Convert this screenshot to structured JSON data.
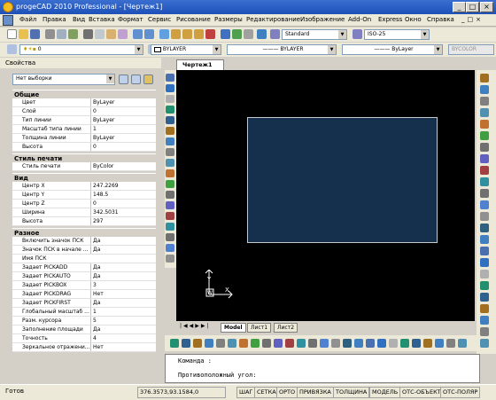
{
  "window": {
    "title": "progeCAD 2010 Professional - [Чертеж1]"
  },
  "menu": [
    "Файл",
    "Правка",
    "Вид",
    "Вставка",
    "Формат",
    "Сервис",
    "Рисование",
    "Размеры",
    "Редактирование",
    "Изображение",
    "Add-On",
    "Express",
    "Окно",
    "Справка"
  ],
  "toolbar": {
    "layer_value": "0",
    "color_value": "BYLAYER",
    "linetype_value": "BYLAYER",
    "lineweight_value": "ByLayer",
    "plotstyle_value": "BYCOLOR",
    "textstyle_value": "Standard",
    "dimstyle_value": "ISO-25"
  },
  "properties": {
    "title": "Свойства",
    "selection": "Нет выборки",
    "sections": [
      {
        "name": "Общие",
        "rows": [
          {
            "k": "Цвет",
            "v": "ByLayer"
          },
          {
            "k": "Слой",
            "v": "0"
          },
          {
            "k": "Тип линии",
            "v": "ByLayer"
          },
          {
            "k": "Масштаб типа линии",
            "v": "1"
          },
          {
            "k": "Толщина линии",
            "v": "ByLayer"
          },
          {
            "k": "Высота",
            "v": "0"
          }
        ]
      },
      {
        "name": "Стиль печати",
        "rows": [
          {
            "k": "Стиль печати",
            "v": "ByColor"
          }
        ]
      },
      {
        "name": "Вид",
        "rows": [
          {
            "k": "Центр X",
            "v": "247.2269"
          },
          {
            "k": "Центр Y",
            "v": "148.5"
          },
          {
            "k": "Центр Z",
            "v": "0"
          },
          {
            "k": "Ширина",
            "v": "342.5031"
          },
          {
            "k": "Высота",
            "v": "297"
          }
        ]
      },
      {
        "name": "Разное",
        "rows": [
          {
            "k": "Включить значок ПСК",
            "v": "Да"
          },
          {
            "k": "Значок ПСК в начале ...",
            "v": "Да"
          },
          {
            "k": "Имя ПСК",
            "v": ""
          },
          {
            "k": "Задает PICKADD",
            "v": "Да"
          },
          {
            "k": "Задает PICKAUTO",
            "v": "Да"
          },
          {
            "k": "Задает PICKBOX",
            "v": "3"
          },
          {
            "k": "Задает PICKDRAG",
            "v": "Нет"
          },
          {
            "k": "Задает PICKFIRST",
            "v": "Да"
          },
          {
            "k": "Глобальный масштаб ...",
            "v": "1"
          },
          {
            "k": "Разм. курсора",
            "v": "5"
          },
          {
            "k": "Заполнение площади",
            "v": "Да"
          },
          {
            "k": "Точность",
            "v": "4"
          },
          {
            "k": "Зеркальное отражени...",
            "v": "Нет"
          }
        ]
      }
    ]
  },
  "document": {
    "tab": "Чертеж1"
  },
  "layout_tabs": [
    "Model",
    "Лист1",
    "Лист2"
  ],
  "command": {
    "line1": "Команда :",
    "line2": "Противоположный угол:"
  },
  "status": {
    "ready": "Готов",
    "coords": "376.3573,93.1584,0",
    "toggles": [
      "ШАГ",
      "СЕТКА",
      "ОРТО",
      "ПРИВЯЗКА",
      "ТОЛЩИНА",
      "МОДЕЛЬ",
      "ОТС-ОБЪЕКТ",
      "ОТС-ПОЛЯР"
    ]
  },
  "colors": {
    "title_bar": "#2458c0",
    "drawing_bg": "#000000",
    "rect_fill": "#14304d"
  }
}
